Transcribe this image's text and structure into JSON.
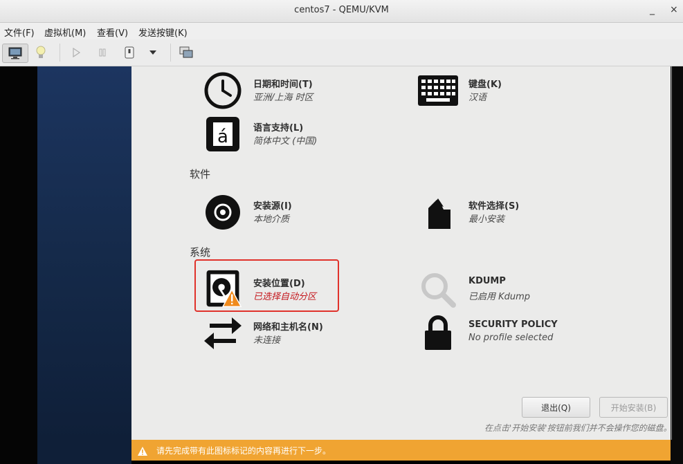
{
  "window": {
    "title": "centos7 - QEMU/KVM",
    "minimize": "_",
    "close": "×"
  },
  "menu": [
    "文件(F)",
    "虚拟机(M)",
    "查看(V)",
    "发送按键(K)"
  ],
  "toolbar": {
    "icons": [
      "monitor-icon",
      "lightbulb-icon",
      "play-icon",
      "pause-icon",
      "power-icon",
      "dropdown-arrow-icon",
      "screenshot-icon"
    ]
  },
  "sections": {
    "software": "软件",
    "system": "系统"
  },
  "spokes": {
    "datetime": {
      "name": "日期和时间(T)",
      "status": "亚洲/上海 时区",
      "icon": "clock-icon"
    },
    "keyboard": {
      "name": "键盘(K)",
      "status": "汉语",
      "icon": "keyboard-icon"
    },
    "language": {
      "name": "语言支持(L)",
      "status": "简体中文 (中国)",
      "icon": "language-icon"
    },
    "source": {
      "name": "安装源(I)",
      "status": "本地介质",
      "icon": "disc-icon"
    },
    "software": {
      "name": "软件选择(S)",
      "status": "最小安装",
      "icon": "package-icon"
    },
    "destination": {
      "name": "安装位置(D)",
      "status": "已选择自动分区",
      "icon": "harddisk-warning-icon"
    },
    "kdump": {
      "name": "KDUMP",
      "status": "已启用 Kdump",
      "icon": "magnifier-icon"
    },
    "network": {
      "name": "网络和主机名(N)",
      "status": "未连接",
      "icon": "network-arrows-icon"
    },
    "security": {
      "name": "SECURITY POLICY",
      "status": "No profile selected",
      "icon": "lock-icon"
    }
  },
  "buttons": {
    "quit": "退出(Q)",
    "begin": "开始安装(B)"
  },
  "hint": "在点击'开始安装'按钮前我们并不会操作您的磁盘。",
  "warning": "请先完成带有此图标标记的内容再进行下一步。",
  "colors": {
    "warning_bar": "#f0a432",
    "highlight": "#e0312a",
    "status_warn": "#c4161c"
  }
}
